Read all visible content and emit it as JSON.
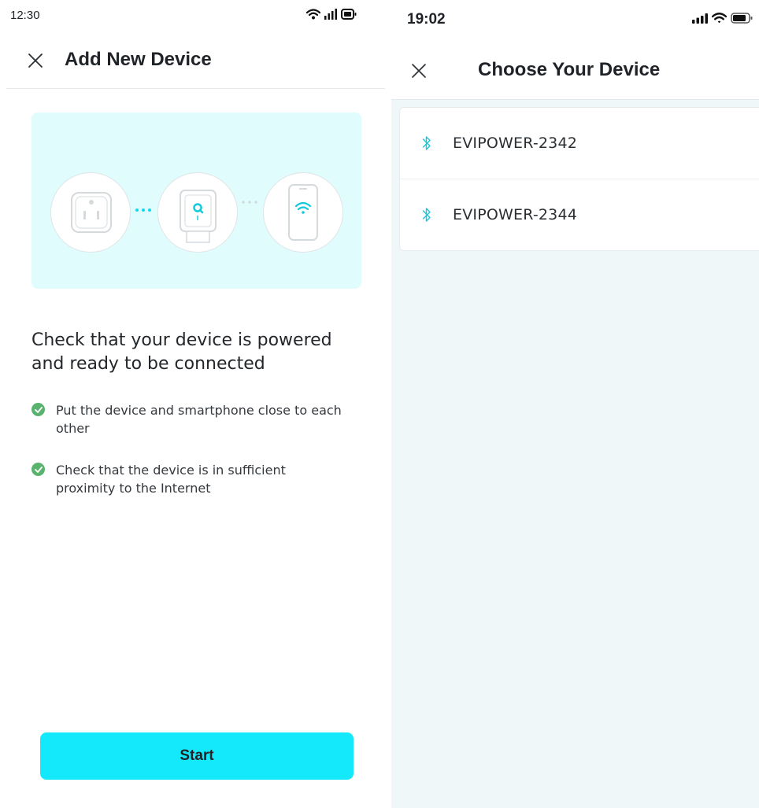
{
  "left_screen": {
    "status_bar": {
      "time": "12:30",
      "icons": [
        "wifi-icon",
        "signal-icon",
        "battery-icon"
      ]
    },
    "header": {
      "title": "Add New Device",
      "close_icon": "close-icon"
    },
    "illustration": {
      "items": [
        "outlet-icon",
        "plug-device-icon",
        "phone-wifi-icon"
      ]
    },
    "heading": "Check that your device is powered and ready to be connected",
    "checklist": [
      {
        "text": "Put the device and smartphone close to each other"
      },
      {
        "text": "Check that the device is in sufficient proximity to the Internet"
      }
    ],
    "start_button": {
      "label": "Start"
    }
  },
  "right_screen": {
    "status_bar": {
      "time": "19:02",
      "icons": [
        "signal-icon",
        "wifi-icon",
        "battery-icon"
      ]
    },
    "header": {
      "title": "Choose Your Device",
      "close_icon": "close-icon"
    },
    "devices": [
      {
        "name": "EVIPOWER-2342",
        "icon": "bluetooth-icon"
      },
      {
        "name": "EVIPOWER-2344",
        "icon": "bluetooth-icon"
      }
    ]
  },
  "colors": {
    "accent": "#13e9fb",
    "illustration_bg": "#e1fcfd",
    "check_green": "#5ab26f",
    "bluetooth": "#17c7d9",
    "list_bg": "#eff7f8"
  }
}
